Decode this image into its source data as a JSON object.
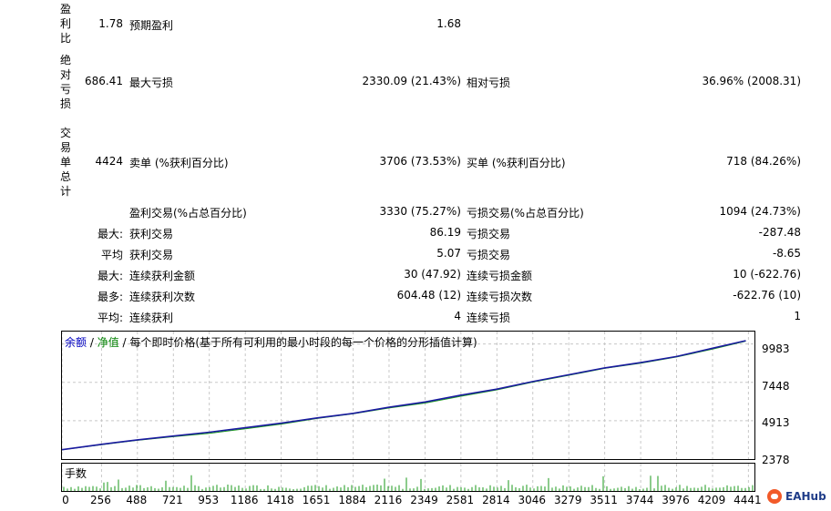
{
  "stats": {
    "profit_factor_label": "盈利比",
    "profit_factor_value": "1.78",
    "expected_payoff_label": "预期盈利",
    "expected_payoff_value": "1.68",
    "abs_drawdown_label": "绝对亏损",
    "abs_drawdown_value": "686.41",
    "max_drawdown_label": "最大亏损",
    "max_drawdown_value": "2330.09 (21.43%)",
    "rel_drawdown_label": "相对亏损",
    "rel_drawdown_value": "36.96% (2008.31)",
    "total_trades_label": "交易单总计",
    "total_trades_value": "4424",
    "short_label": "卖单 (%获利百分比)",
    "short_value": "3706 (73.53%)",
    "long_label": "买单 (%获利百分比)",
    "long_value": "718 (84.26%)",
    "profit_trades_label": "盈利交易(%占总百分比)",
    "profit_trades_value": "3330 (75.27%)",
    "loss_trades_label": "亏损交易(%占总百分比)",
    "loss_trades_value": "1094 (24.73%)",
    "largest_prefix": "最大:",
    "largest_profit_label": "获利交易",
    "largest_profit_value": "86.19",
    "largest_loss_label": "亏损交易",
    "largest_loss_value": "-287.48",
    "average_prefix": "平均",
    "avg_profit_label": "获利交易",
    "avg_profit_value": "5.07",
    "avg_loss_label": "亏损交易",
    "avg_loss_value": "-8.65",
    "max_cons_prefix": "最大:",
    "max_cons_wins_label": "连续获利金额",
    "max_cons_wins_value": "30 (47.92)",
    "max_cons_losses_label": "连续亏损金额",
    "max_cons_losses_value": "10 (-622.76)",
    "maximal_prefix": "最多:",
    "max_cons_profit_label": "连续获利次数",
    "max_cons_profit_value": "604.48 (12)",
    "max_cons_loss_label": "连续亏损次数",
    "max_cons_loss_value": "-622.76 (10)",
    "avg_cons_prefix": "平均:",
    "avg_cons_wins_label": "连续获利",
    "avg_cons_wins_value": "4",
    "avg_cons_losses_label": "连续亏损",
    "avg_cons_losses_value": "1"
  },
  "chart_legend": {
    "balance": "余额",
    "sep1": " / ",
    "equity": "净值",
    "sep2": " / ",
    "model": "每个即时价格(基于所有可利用的最小时段的每一个价格的分形插值计算)"
  },
  "volume_label": "手数",
  "watermark": "EAHub",
  "colors": {
    "balance": "#1a1aa0",
    "equity": "#1a9a1a",
    "grid": "#c8c8c8",
    "legend_balance": "#0000c0",
    "legend_equity": "#008000"
  },
  "chart_data": {
    "type": "line",
    "title": "",
    "ylim": [
      2378,
      10800
    ],
    "yticks": [
      "9983",
      "7448",
      "4913",
      "2378"
    ],
    "xticks": [
      "0",
      "256",
      "488",
      "721",
      "953",
      "1186",
      "1418",
      "1651",
      "1884",
      "2116",
      "2349",
      "2581",
      "2814",
      "3046",
      "3279",
      "3511",
      "3744",
      "3976",
      "4209",
      "4441"
    ],
    "x": [
      0,
      256,
      488,
      721,
      953,
      1186,
      1418,
      1651,
      1884,
      2116,
      2349,
      2581,
      2814,
      3046,
      3279,
      3511,
      3744,
      3976,
      4209,
      4424
    ],
    "series": [
      {
        "name": "余额",
        "values": [
          3000,
          3350,
          3650,
          3900,
          4150,
          4450,
          4750,
          5100,
          5400,
          5800,
          6150,
          6600,
          7000,
          7500,
          7950,
          8400,
          8750,
          9150,
          9700,
          10200
        ]
      },
      {
        "name": "净值",
        "values": [
          2990,
          3330,
          3620,
          3860,
          4080,
          4380,
          4690,
          5060,
          5370,
          5750,
          6080,
          6530,
          6950,
          7460,
          7910,
          8370,
          8710,
          9120,
          9640,
          10170
        ]
      }
    ]
  }
}
